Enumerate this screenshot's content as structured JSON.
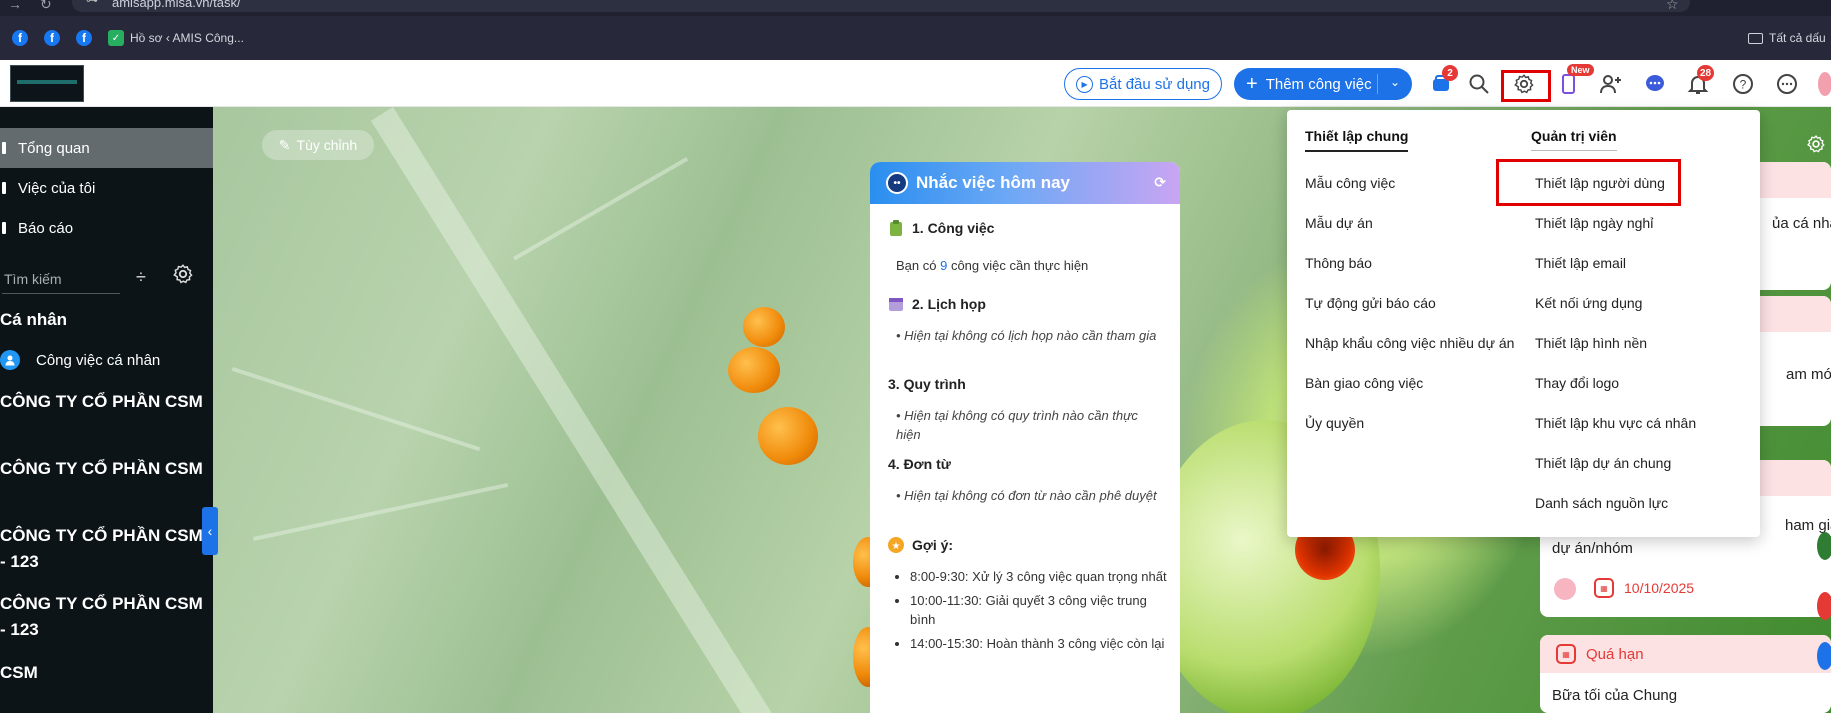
{
  "browser": {
    "url": "amisapp.misa.vn/task/",
    "bookmarks": [
      {
        "icon": "facebook-icon",
        "label": ""
      },
      {
        "icon": "facebook-icon",
        "label": ""
      },
      {
        "icon": "facebook-icon",
        "label": ""
      },
      {
        "icon": "misa-icon",
        "label": "Hồ sơ ‹ AMIS Công..."
      }
    ],
    "all_bookmarks": "Tất cả dấu"
  },
  "header": {
    "start_button": "Bắt đầu sử dụng",
    "add_button": "Thêm công việc",
    "cart_badge": "2",
    "new_badge": "New",
    "notification_badge": "28"
  },
  "sidebar": {
    "nav": [
      {
        "label": "Tổng quan",
        "active": true
      },
      {
        "label": "Việc của tôi",
        "active": false
      },
      {
        "label": "Báo cáo",
        "active": false
      }
    ],
    "search_placeholder": "Tìm kiếm",
    "personal_section": "Cá nhân",
    "personal_item": "Công việc cá nhân",
    "groups": [
      "CÔNG TY CỔ PHẦN CSM",
      "CÔNG TY CỔ PHẦN CSM",
      "CÔNG TY CỔ PHẦN CSM - 123",
      "CÔNG TY CỔ PHẦN CSM - 123",
      "CSM"
    ]
  },
  "main": {
    "customize_button": "Tùy chỉnh"
  },
  "reminder": {
    "title": "Nhắc việc hôm nay",
    "sections": [
      {
        "title": "1.  Công việc",
        "text_prefix": "Bạn có ",
        "count": "9",
        "text_suffix": " công việc cần thực hiện"
      },
      {
        "title": "2.  Lịch họp",
        "text": "• Hiện tại không có lịch họp nào cần tham gia"
      },
      {
        "title": "3.  Quy trình",
        "text": "• Hiện tại không có quy trình nào cần thực hiện"
      },
      {
        "title": "4.  Đơn từ",
        "text": "• Hiện tại không có đơn từ nào cần phê duyệt"
      }
    ],
    "tips_title": "Gợi ý:",
    "tips": [
      "8:00-9:30: Xử lý 3 công việc quan trọng nhất",
      "10:00-11:30: Giải quyết 3 công việc trung bình",
      "14:00-15:30: Hoàn thành 3 công việc còn lại"
    ]
  },
  "dropdown": {
    "general_title": "Thiết lập chung",
    "general_items": [
      "Mẫu công việc",
      "Mẫu dự án",
      "Thông báo",
      "Tự động gửi báo cáo",
      "Nhập khẩu công việc nhiều dự án",
      "Bàn giao công việc",
      "Ủy quyền"
    ],
    "admin_title": "Quản trị viên",
    "admin_items": [
      "Thiết lập người dùng",
      "Thiết lập ngày nghỉ",
      "Thiết lập email",
      "Kết nối ứng dụng",
      "Thiết lập hình nền",
      "Thay đổi logo",
      "Thiết lập khu vực cá nhân",
      "Thiết lập dự án chung",
      "Danh sách nguồn lực"
    ]
  },
  "right_panel": {
    "texts": [
      "ủa cá nhân",
      "am mới",
      "ham gia",
      "dự án/nhóm"
    ],
    "date": "10/10/2025",
    "overdue_title": "Quá hạn",
    "overdue_item": "Bữa tối của Chung"
  },
  "colors": {
    "accent": "#1d72e8",
    "sidebar_bg": "#0c1418",
    "highlight": "#e00000",
    "danger": "#e53935"
  }
}
